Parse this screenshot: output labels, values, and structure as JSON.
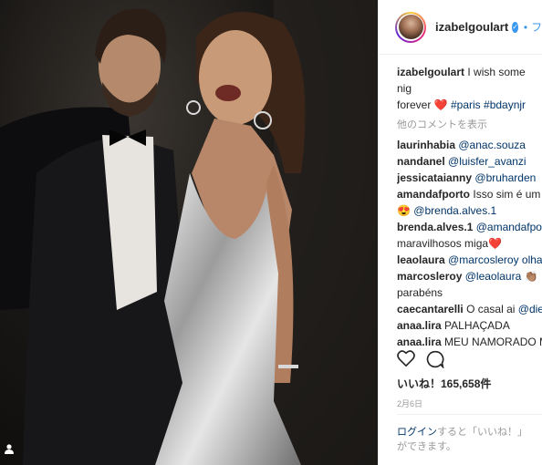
{
  "post": {
    "username": "izabelgoulart",
    "follow_bullet": "•",
    "follow_label": "フ",
    "caption": {
      "username": "izabelgoulart",
      "text": "I wish some nig",
      "text2": "forever",
      "heart": "❤️",
      "hashtags": "#paris #bdaynjr"
    },
    "more_comments": "他のコメントを表示",
    "comments": [
      {
        "user": "laurinhabia",
        "text": "@anac.souza",
        "mention": true
      },
      {
        "user": "nandanel",
        "text": "@luisfer_avanzi",
        "mention": true
      },
      {
        "user": "jessicataianny",
        "text": "@bruharden",
        "mention": true
      },
      {
        "user": "amandafporto",
        "text": "Isso sim é um",
        "line2_emoji": "😍",
        "line2_mention": "@brenda.alves.1"
      },
      {
        "user": "brenda.alves.1",
        "text": "@amandafpo",
        "line2_text": "maravilhosos miga",
        "line2_emoji": "❤️"
      },
      {
        "user": "leaolaura",
        "text": "@marcosleroy olha"
      },
      {
        "user": "marcosleroy",
        "text": "@leaolaura",
        "emoji": "👏🏽",
        "line2_text": "parabéns"
      },
      {
        "user": "caecantarelli",
        "text": "O casal ai",
        "mention_tail": "@die"
      },
      {
        "user": "anaa.lira",
        "text": "PALHAÇADA"
      },
      {
        "user": "anaa.lira",
        "text": "MEU NAMORADO M"
      }
    ],
    "likes": "いいね！165,658件",
    "date": "2月6日",
    "login_link": "ログイン",
    "login_text1": "すると「いいね！」",
    "login_text2": "ができます。"
  },
  "icons": {
    "like": "heart-outline-icon",
    "comment": "speech-bubble-icon",
    "user_tag": "person-icon",
    "verified": "verified-badge-icon"
  },
  "colors": {
    "link": "#003569",
    "accent_blue": "#3897f0",
    "heart_red": "#ed4956",
    "muted": "#999999"
  }
}
